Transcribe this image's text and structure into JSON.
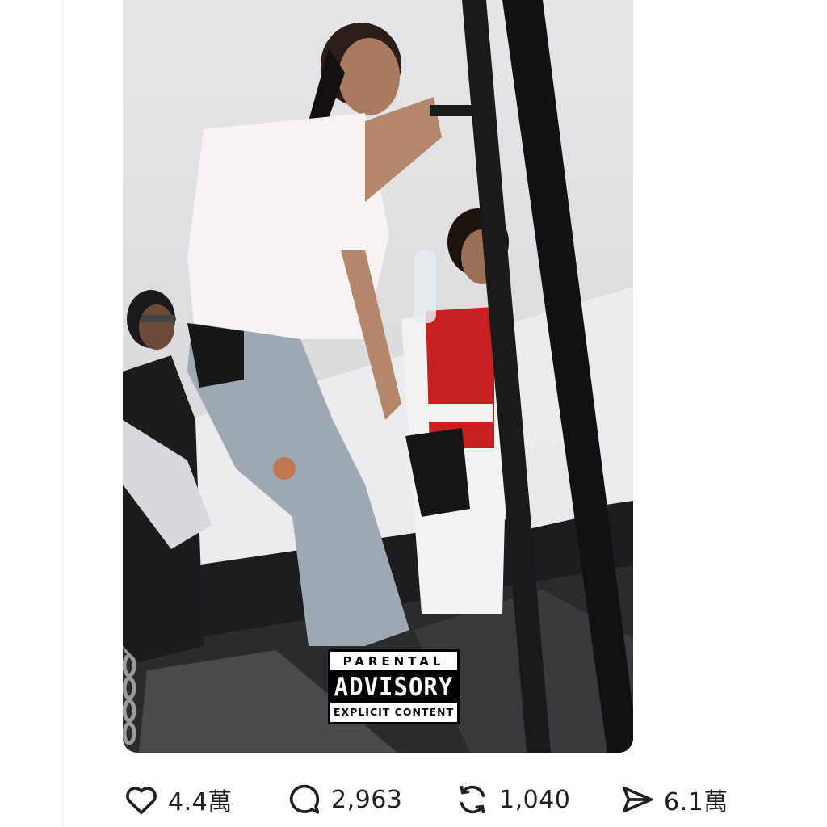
{
  "post": {
    "media": {
      "description_icon": "photo",
      "advisory": {
        "line1": "PARENTAL",
        "line2": "ADVISORY",
        "line3": "EXPLICIT CONTENT"
      }
    },
    "actions": {
      "like": {
        "icon": "heart-icon",
        "count": "4.4萬"
      },
      "reply": {
        "icon": "comment-icon",
        "count": "2,963"
      },
      "repost": {
        "icon": "repost-icon",
        "count": "1,040"
      },
      "share": {
        "icon": "send-icon",
        "count": "6.1萬"
      }
    }
  }
}
